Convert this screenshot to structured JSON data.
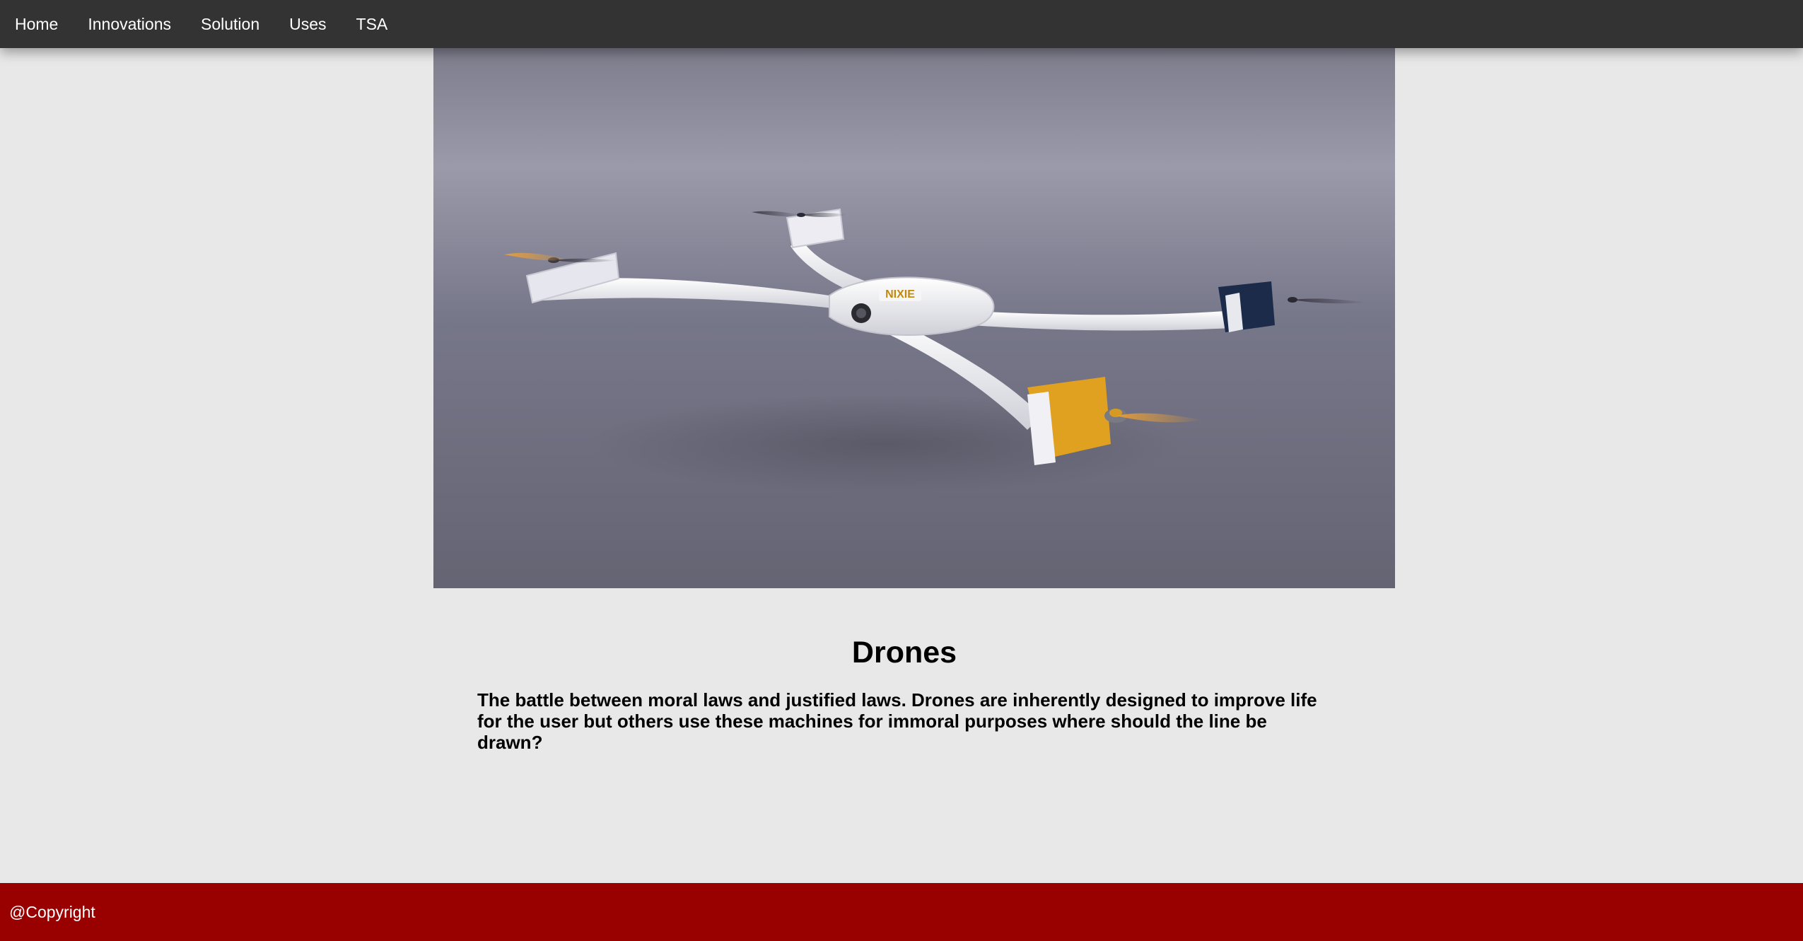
{
  "nav": {
    "items": [
      {
        "label": "Home"
      },
      {
        "label": "Innovations"
      },
      {
        "label": "Solution"
      },
      {
        "label": "Uses"
      },
      {
        "label": "TSA"
      }
    ]
  },
  "hero": {
    "image": "drone-photo",
    "drone_logo": "NIXIE"
  },
  "main": {
    "title": "Drones",
    "body": "The battle between moral laws and justified laws. Drones are inherently designed to improve life for the user but others use these machines for immoral purposes where should the line be drawn?"
  },
  "footer": {
    "text": "@Copyright"
  },
  "colors": {
    "nav_bg": "#333333",
    "page_bg": "#e8e8e8",
    "footer_bg": "#990000",
    "drone_accent": "#e0a020",
    "drone_navy": "#1c2b4a"
  }
}
